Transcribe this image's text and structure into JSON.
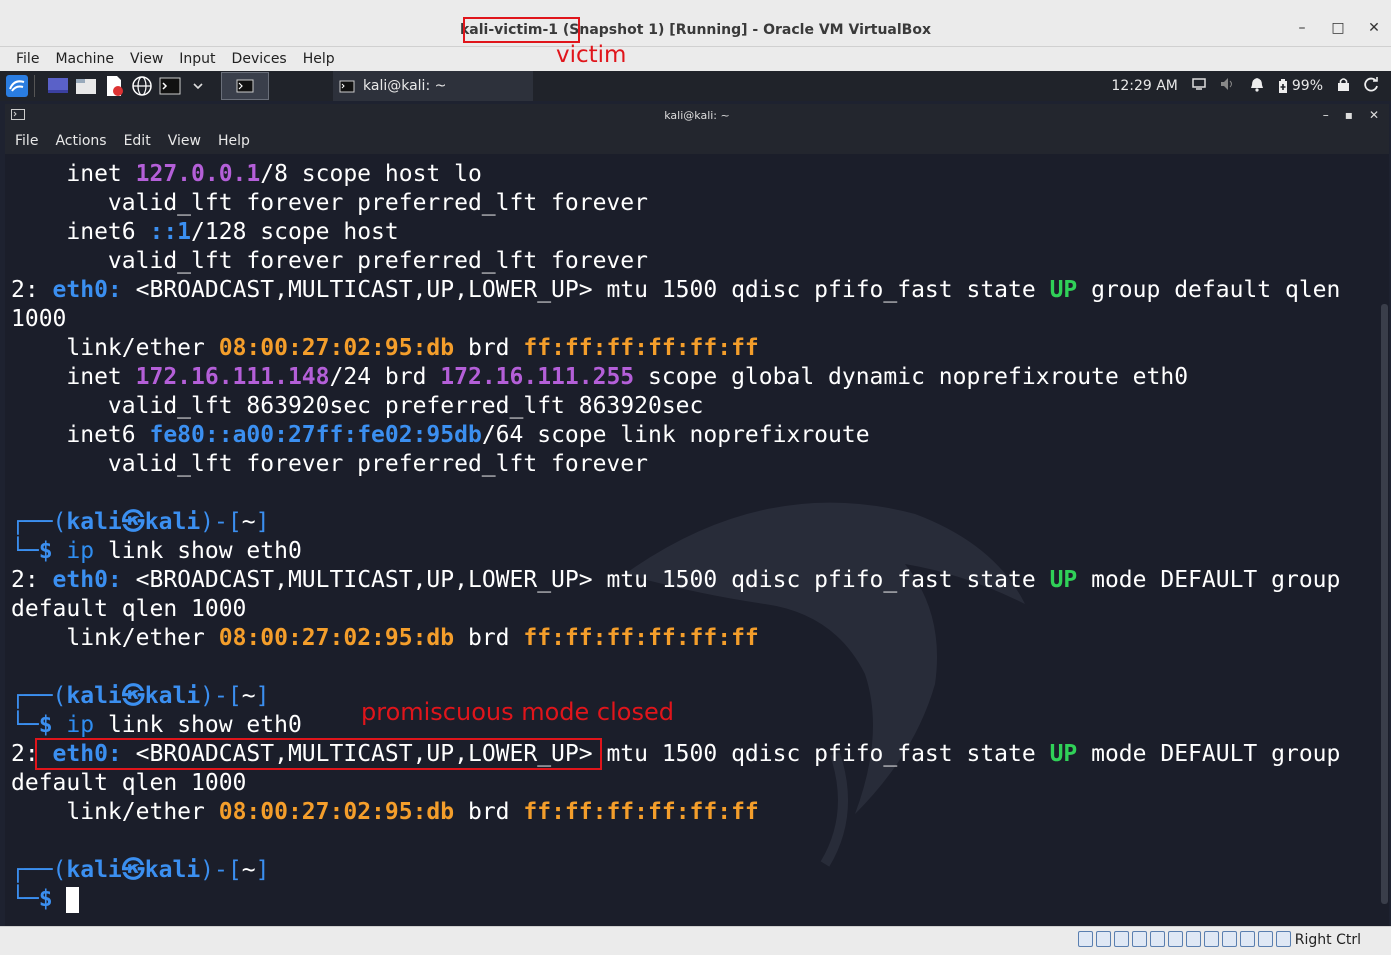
{
  "vbox": {
    "title": "kali-victim-1 (Snapshot 1) [Running] - Oracle VM VirtualBox",
    "window_buttons": [
      "–",
      "□",
      "✕"
    ],
    "menu": [
      "File",
      "Machine",
      "View",
      "Input",
      "Devices",
      "Help"
    ],
    "host_key": "Right Ctrl"
  },
  "annotations": {
    "victim_label": "victim",
    "promisc_label": "promiscuous mode closed",
    "color": "#e0151b"
  },
  "panel": {
    "task_window_label": "kali@kali: ~",
    "clock": "12:29 AM",
    "battery": "99%"
  },
  "terminal": {
    "title": "kali@kali: ~",
    "window_buttons": [
      "–",
      "▪",
      "✕"
    ],
    "menu": [
      "File",
      "Actions",
      "Edit",
      "View",
      "Help"
    ],
    "lines": [
      [
        {
          "t": "    inet "
        },
        {
          "t": "127.0.0.1",
          "c": "pur"
        },
        {
          "t": "/8 scope host lo"
        }
      ],
      [
        {
          "t": "       valid_lft forever preferred_lft forever"
        }
      ],
      [
        {
          "t": "    inet6 "
        },
        {
          "t": "::1",
          "c": "blu"
        },
        {
          "t": "/128 scope host"
        }
      ],
      [
        {
          "t": "       valid_lft forever preferred_lft forever"
        }
      ],
      [
        {
          "t": "2: "
        },
        {
          "t": "eth0:",
          "c": "blu"
        },
        {
          "t": " <BROADCAST,MULTICAST,UP,LOWER_UP> mtu 1500 qdisc pfifo_fast state "
        },
        {
          "t": "UP",
          "c": "grn"
        },
        {
          "t": " group default qlen"
        }
      ],
      [
        {
          "t": "1000"
        }
      ],
      [
        {
          "t": "    link/ether "
        },
        {
          "t": "08:00:27:02:95:db",
          "c": "org"
        },
        {
          "t": " brd "
        },
        {
          "t": "ff:ff:ff:ff:ff:ff",
          "c": "org"
        }
      ],
      [
        {
          "t": "    inet "
        },
        {
          "t": "172.16.111.148",
          "c": "pur"
        },
        {
          "t": "/24 brd "
        },
        {
          "t": "172.16.111.255",
          "c": "pur"
        },
        {
          "t": " scope global dynamic noprefixroute eth0"
        }
      ],
      [
        {
          "t": "       valid_lft 863920sec preferred_lft 863920sec"
        }
      ],
      [
        {
          "t": "    inet6 "
        },
        {
          "t": "fe80::a00:27ff:fe02:95db",
          "c": "blu"
        },
        {
          "t": "/64 scope link noprefixroute"
        }
      ],
      [
        {
          "t": "       valid_lft forever preferred_lft forever"
        }
      ],
      [],
      [
        {
          "t": "┌──(",
          "c": "frame"
        },
        {
          "t": "kali㉿kali",
          "c": "blu"
        },
        {
          "t": ")-[",
          "c": "frame"
        },
        {
          "t": "~"
        },
        {
          "t": "]",
          "c": "frame"
        }
      ],
      [
        {
          "t": "└─",
          "c": "frame"
        },
        {
          "t": "$ ",
          "c": "blu"
        },
        {
          "t": "ip",
          "c": "cmd"
        },
        {
          "t": " link show eth0"
        }
      ],
      [
        {
          "t": "2: "
        },
        {
          "t": "eth0:",
          "c": "blu"
        },
        {
          "t": " <BROADCAST,MULTICAST,UP,LOWER_UP> mtu 1500 qdisc pfifo_fast state "
        },
        {
          "t": "UP",
          "c": "grn"
        },
        {
          "t": " mode DEFAULT group"
        }
      ],
      [
        {
          "t": "default qlen 1000"
        }
      ],
      [
        {
          "t": "    link/ether "
        },
        {
          "t": "08:00:27:02:95:db",
          "c": "org"
        },
        {
          "t": " brd "
        },
        {
          "t": "ff:ff:ff:ff:ff:ff",
          "c": "org"
        }
      ],
      [],
      [
        {
          "t": "┌──(",
          "c": "frame"
        },
        {
          "t": "kali㉿kali",
          "c": "blu"
        },
        {
          "t": ")-[",
          "c": "frame"
        },
        {
          "t": "~"
        },
        {
          "t": "]",
          "c": "frame"
        }
      ],
      [
        {
          "t": "└─",
          "c": "frame"
        },
        {
          "t": "$ ",
          "c": "blu"
        },
        {
          "t": "ip",
          "c": "cmd"
        },
        {
          "t": " link show eth0"
        }
      ],
      [
        {
          "t": "2: "
        },
        {
          "t": "eth0:",
          "c": "blu"
        },
        {
          "t": " <BROADCAST,MULTICAST,UP,LOWER_UP> mtu 1500 qdisc pfifo_fast state "
        },
        {
          "t": "UP",
          "c": "grn"
        },
        {
          "t": " mode DEFAULT group"
        }
      ],
      [
        {
          "t": "default qlen 1000"
        }
      ],
      [
        {
          "t": "    link/ether "
        },
        {
          "t": "08:00:27:02:95:db",
          "c": "org"
        },
        {
          "t": " brd "
        },
        {
          "t": "ff:ff:ff:ff:ff:ff",
          "c": "org"
        }
      ],
      [],
      [
        {
          "t": "┌──(",
          "c": "frame"
        },
        {
          "t": "kali㉿kali",
          "c": "blu"
        },
        {
          "t": ")-[",
          "c": "frame"
        },
        {
          "t": "~"
        },
        {
          "t": "]",
          "c": "frame"
        }
      ],
      [
        {
          "t": "└─",
          "c": "frame"
        },
        {
          "t": "$ ",
          "c": "blu"
        },
        {
          "t": "CURSOR",
          "c": "cursor"
        }
      ]
    ]
  }
}
